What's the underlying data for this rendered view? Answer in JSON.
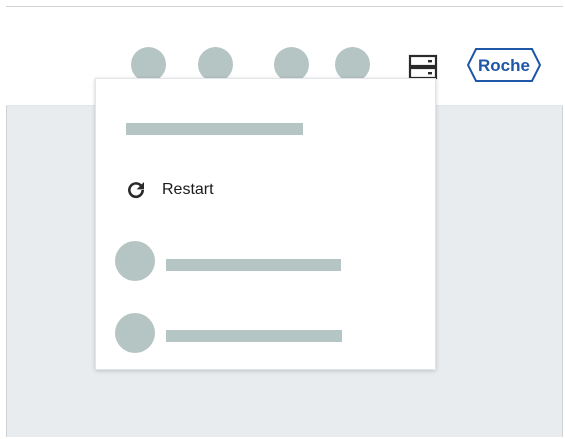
{
  "header": {
    "logo_text": "Roche",
    "icons": [
      "nav-circle",
      "nav-circle",
      "nav-circle",
      "nav-circle",
      "server-icon"
    ]
  },
  "dropdown": {
    "restart_label": "Restart",
    "restart_icon": "refresh-icon"
  },
  "colors": {
    "placeholder": "#b5c5c3",
    "background": "#e8ecef",
    "brand": "#1e56a8",
    "text": "#1a1a1a"
  }
}
